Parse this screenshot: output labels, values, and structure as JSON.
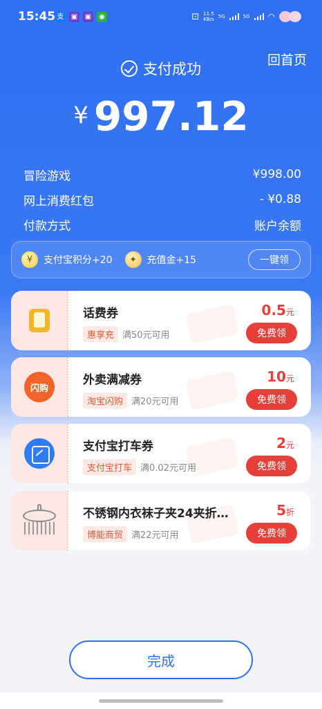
{
  "status_bar": {
    "time": "15:45",
    "net_speed_value": "11.5",
    "net_speed_unit": "KB/s",
    "sig1": "5G",
    "sig2": "5G"
  },
  "header": {
    "home_label": "回首页",
    "success_label": "支付成功"
  },
  "amount": {
    "currency": "¥",
    "value": "997.12"
  },
  "details": [
    {
      "label": "冒险游戏",
      "value": "¥998.00"
    },
    {
      "label": "网上消费红包",
      "value": "- ¥0.88"
    },
    {
      "label": "付款方式",
      "value": "账户余额"
    }
  ],
  "rewards": {
    "points_label": "支付宝积分+20",
    "recharge_label": "充值金+15",
    "one_click_label": "一键领"
  },
  "coupons": [
    {
      "title": "话费券",
      "tag": "惠享充",
      "condition": "满50元可用",
      "value": "0.5",
      "unit": "元",
      "button": "免费领",
      "icon": "phone-icon"
    },
    {
      "title": "外卖满减券",
      "tag": "淘宝闪购",
      "condition": "满20元可用",
      "value": "10",
      "unit": "元",
      "button": "免费领",
      "icon": "flash-buy-icon",
      "icon_text": "闪购"
    },
    {
      "title": "支付宝打车券",
      "tag": "支付宝打车",
      "condition": "满0.02元可用",
      "value": "2",
      "unit": "元",
      "button": "免费领",
      "icon": "taxi-icon"
    },
    {
      "title": "不锈钢内衣袜子夹24夹折…",
      "tag": "博能商贸",
      "condition": "满22元可用",
      "value": "5",
      "unit": "折",
      "button": "免费领",
      "icon": "hanger-icon"
    }
  ],
  "footer": {
    "done_label": "完成"
  },
  "colors": {
    "primary_blue": "#2f6ff2",
    "coupon_red": "#e5403a"
  }
}
